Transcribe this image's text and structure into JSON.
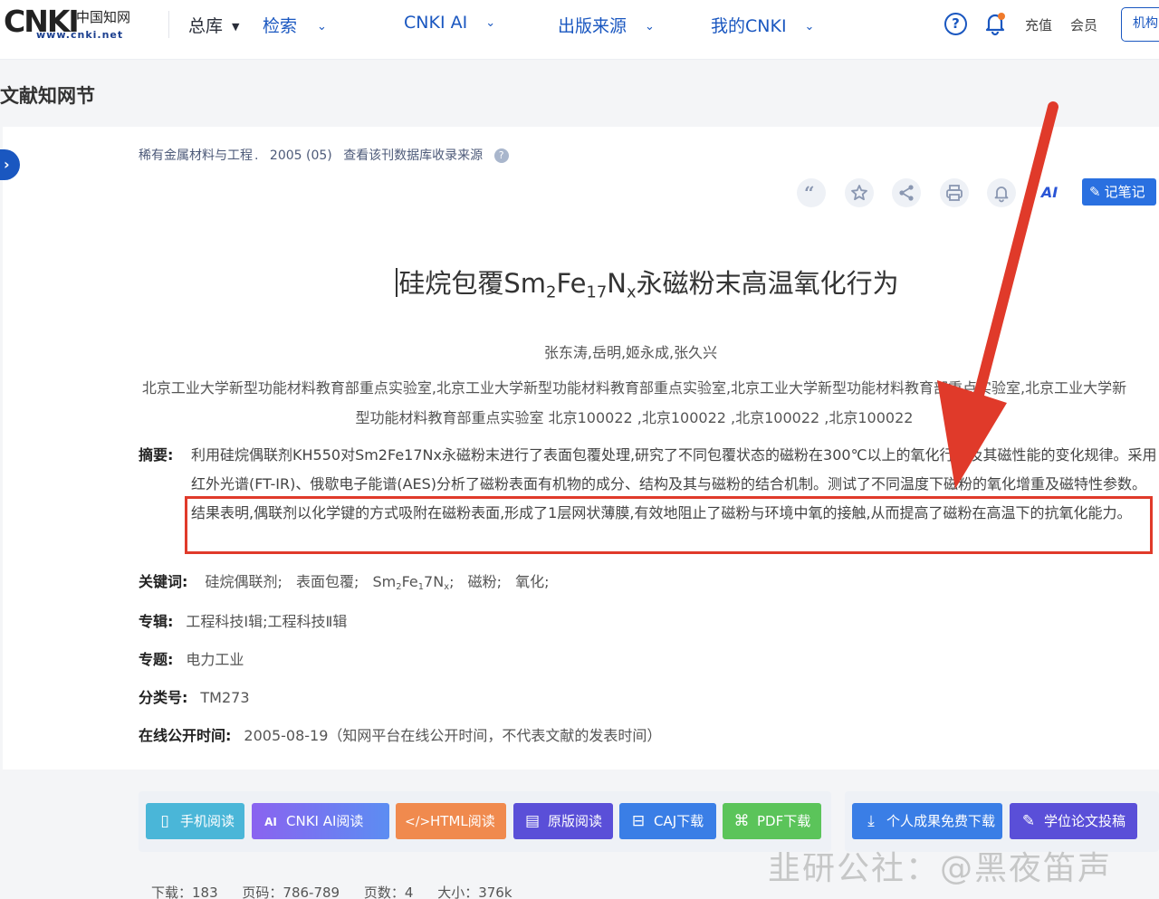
{
  "header": {
    "logo_main": "CNKI",
    "logo_cn": "中国知网",
    "logo_url": "www.cnki.net",
    "nav": [
      {
        "label": "总库"
      },
      {
        "label": "检索"
      },
      {
        "label": "CNKI AI"
      },
      {
        "label": "出版来源"
      },
      {
        "label": "我的CNKI"
      }
    ],
    "help_glyph": "?",
    "recharge": "充值",
    "member": "会员",
    "org": "机构"
  },
  "section_title": "文献知网节",
  "source": {
    "journal": "稀有金属材料与工程",
    "issue": "2005 (05)",
    "link": "查看该刊数据库收录来源",
    "q_glyph": "?"
  },
  "tools": {
    "ai_label": "AI",
    "note_label": "记笔记"
  },
  "paper": {
    "title_pre": "硅烷包覆Sm",
    "title_sub1": "2",
    "title_mid1": "Fe",
    "title_sub2": "17",
    "title_mid2": "N",
    "title_sub3": "x",
    "title_post": "永磁粉末高温氧化行为",
    "authors": "张东涛,岳明,姬永成,张久兴",
    "affiliation": "北京工业大学新型功能材料教育部重点实验室,北京工业大学新型功能材料教育部重点实验室,北京工业大学新型功能材料教育部重点实验室,北京工业大学新型功能材料教育部重点实验室 北京100022 ,北京100022 ,北京100022 ,北京100022",
    "abstract_label": "摘要:",
    "abstract": "利用硅烷偶联剂KH550对Sm2Fe17Nx永磁粉末进行了表面包覆处理,研究了不同包覆状态的磁粉在300℃以上的氧化行为及其磁性能的变化规律。采用红外光谱(FT-IR)、俄歇电子能谱(AES)分析了磁粉表面有机物的成分、结构及其与磁粉的结合机制。测试了不同温度下磁粉的氧化增重及磁特性参数。结果表明,偶联剂以化学键的方式吸附在磁粉表面,形成了1层网状薄膜,有效地阻止了磁粉与环境中氧的接触,从而提高了磁粉在高温下的抗氧化能力。",
    "keywords_label": "关键词:",
    "kw1": "硅烷偶联剂;",
    "kw2": "表面包覆;",
    "kw3_pre": "Sm",
    "kw3_sub1": "2",
    "kw3_mid": "Fe",
    "kw3_sub2": "1",
    "kw3_mid2": "7N",
    "kw3_sub3": "x",
    "kw3_post": ";",
    "kw4": "磁粉;",
    "kw5": "氧化;",
    "series_label": "专辑:",
    "series": "工程科技Ⅰ辑;工程科技Ⅱ辑",
    "topic_label": "专题:",
    "topic": "电力工业",
    "class_label": "分类号:",
    "class": "TM273",
    "online_label": "在线公开时间:",
    "online": "2005-08-19（知网平台在线公开时间，不代表文献的发表时间）"
  },
  "actions": {
    "mobile": "手机阅读",
    "ai_read": "CNKI AI阅读",
    "html": "HTML阅读",
    "original": "原版阅读",
    "caj": "CAJ下载",
    "pdf": "PDF下载",
    "personal": "个人成果免费下载",
    "thesis": "学位论文投稿"
  },
  "stats": {
    "downloads": "下载：183",
    "pages": "页码：786-789",
    "page_count": "页数：4",
    "size": "大小：376k"
  },
  "watermark": "韭研公社：@黑夜笛声",
  "colors": {
    "brand_blue": "#1a57c0",
    "annotation_red": "#e03a2a"
  }
}
